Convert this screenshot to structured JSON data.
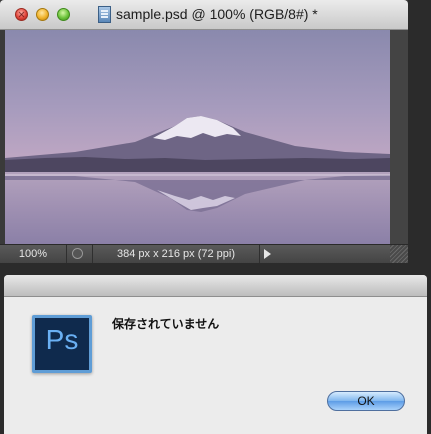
{
  "document_window": {
    "title": "sample.psd @ 100% (RGB/8#) *",
    "statusbar": {
      "zoom": "100%",
      "dimensions": "384 px x 216 px (72 ppi)"
    },
    "icons": [
      "close-button",
      "minimize-button",
      "zoom-button",
      "document-icon",
      "status-icon",
      "disclosure-arrow-icon",
      "resize-grip"
    ]
  },
  "dialog": {
    "message": "保存されていません",
    "icon_text": "Ps",
    "ok_label": "OK"
  },
  "colors": {
    "window_gray": "#3a3a3a",
    "dialog_bg": "#ececec",
    "ok_button_blue": "#5c9ce6",
    "ps_icon_bg": "#0f2a4d",
    "ps_icon_border": "#5f9dd6"
  }
}
